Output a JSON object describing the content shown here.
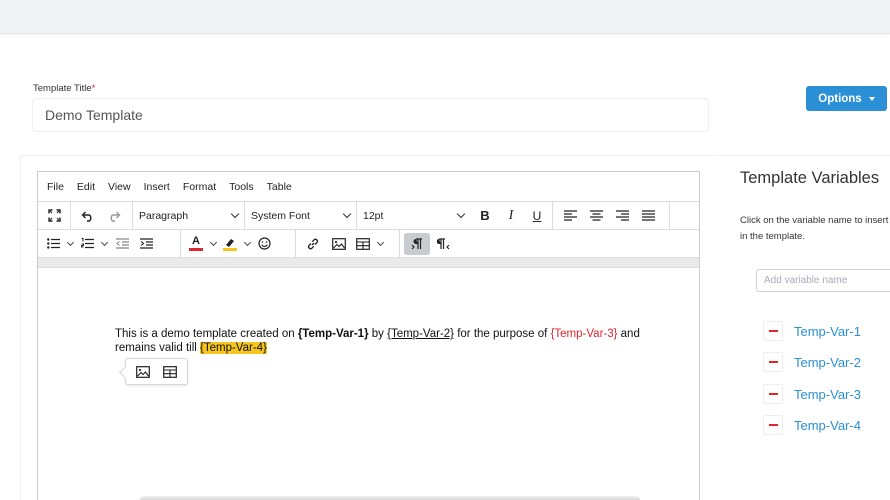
{
  "form": {
    "title_label": "Template Title",
    "required_mark": "*",
    "title_value": "Demo Template",
    "options_label": "Options"
  },
  "editor": {
    "menu": [
      "File",
      "Edit",
      "View",
      "Insert",
      "Format",
      "Tools",
      "Table"
    ],
    "block_format": "Paragraph",
    "font_family": "System Font",
    "font_size": "12pt",
    "content": {
      "t1": "This is a demo template created on ",
      "var1": "{Temp-Var-1}",
      "t2": " by ",
      "var2": "{Temp-Var-2}",
      "t3": " for the purpose of ",
      "var3": "{Temp-Var-3}",
      "t4": " and remains valid till ",
      "var4": "{Temp-Var-4}"
    },
    "colors": {
      "text_color": "#e0262f",
      "highlight": "#f7c61e"
    }
  },
  "variables_panel": {
    "title": "Template Variables",
    "description": "Click on the variable name to insert it in the template.",
    "input_placeholder": "Add variable name",
    "items": [
      "Temp-Var-1",
      "Temp-Var-2",
      "Temp-Var-3",
      "Temp-Var-4"
    ]
  }
}
